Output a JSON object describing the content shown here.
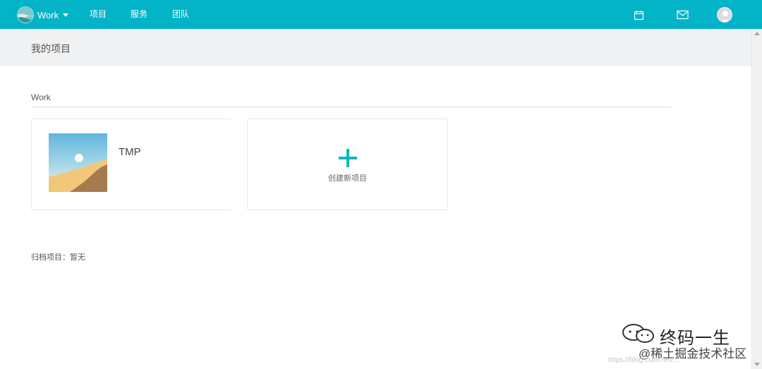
{
  "app": {
    "brand": "Work",
    "nav": [
      "项目",
      "服务",
      "团队"
    ]
  },
  "page": {
    "title": "我的项目"
  },
  "section": {
    "title": "Work",
    "projects": [
      {
        "name": "TMP"
      }
    ],
    "create_label": "创建新项目"
  },
  "archive": {
    "label": "归档项目：",
    "value": "暂无"
  },
  "icons": {
    "calendar": "calendar-icon",
    "mail": "mail-icon",
    "plus": "plus-icon",
    "caret": "chevron-down-icon"
  },
  "colors": {
    "topbar": "#03b3c7",
    "accent": "#12b3c5",
    "subheader": "#f0f1f3"
  },
  "watermark": {
    "title": "终码一生",
    "subtitle": "@稀土掘金技术社区",
    "faint": "https://blog.csdn.net/..."
  }
}
